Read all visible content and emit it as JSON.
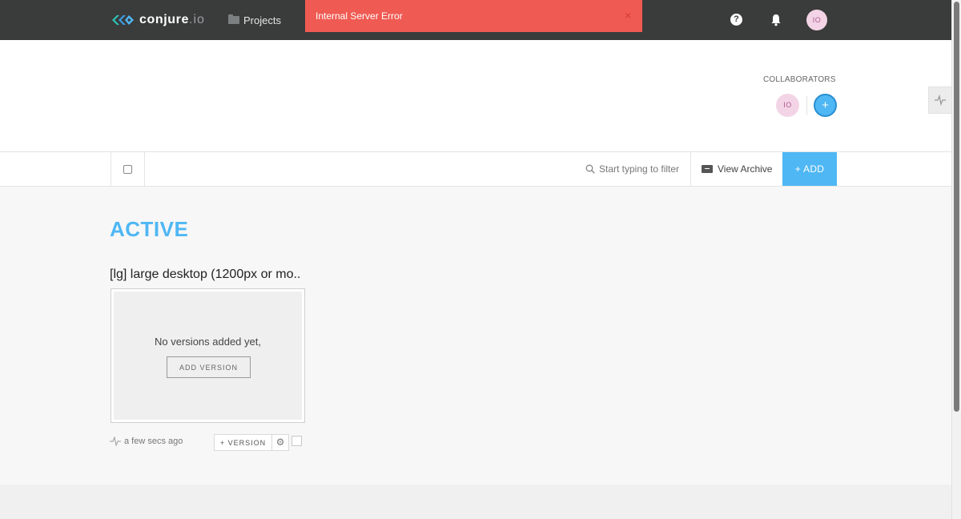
{
  "nav": {
    "logo_text": "conjure",
    "logo_suffix": ".io",
    "projects_label": "Projects",
    "help_glyph": "?",
    "user_initials": "IO",
    "icons": {
      "logo": "conjure-logo-icon",
      "projects": "folder-icon",
      "help": "help-icon",
      "notifications": "bell-icon"
    }
  },
  "error": {
    "message": "Internal Server Error",
    "close_glyph": "×",
    "color": "#ef5a52"
  },
  "header": {
    "collaborators_label": "COLLABORATORS",
    "collaborator_initials": "IO",
    "add_glyph": "+"
  },
  "toolbar": {
    "filter_placeholder": "Start typing to filter",
    "view_archive_label": "View Archive",
    "add_label": "+ ADD"
  },
  "main": {
    "section_title": "ACTIVE",
    "board": {
      "title": "[lg] large desktop (1200px or mo..",
      "empty_text": "No versions added yet,",
      "add_version_label": "ADD VERSION",
      "timestamp": "a few secs ago",
      "version_button_label": "+ VERSION",
      "gear_glyph": "⚙"
    }
  },
  "colors": {
    "accent": "#4fb7f4",
    "nav_bg": "#3a3b3b",
    "avatar_bg": "#f3d4e6"
  }
}
